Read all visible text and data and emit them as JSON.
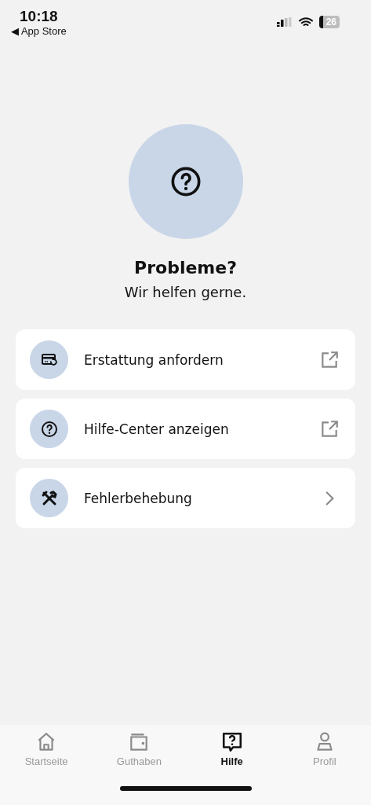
{
  "status_bar": {
    "time": "10:18",
    "back_label": "◀ App Store",
    "battery": "26"
  },
  "hero": {
    "title": "Probleme?",
    "subtitle": "Wir helfen gerne."
  },
  "items": [
    {
      "label": "Erstattung anfordern",
      "kind": "external"
    },
    {
      "label": "Hilfe-Center anzeigen",
      "kind": "external"
    },
    {
      "label": "Fehlerbehebung",
      "kind": "navigate"
    }
  ],
  "tabs": [
    {
      "label": "Startseite",
      "selected": false
    },
    {
      "label": "Guthaben",
      "selected": false
    },
    {
      "label": "Hilfe",
      "selected": true
    },
    {
      "label": "Profil",
      "selected": false
    }
  ]
}
